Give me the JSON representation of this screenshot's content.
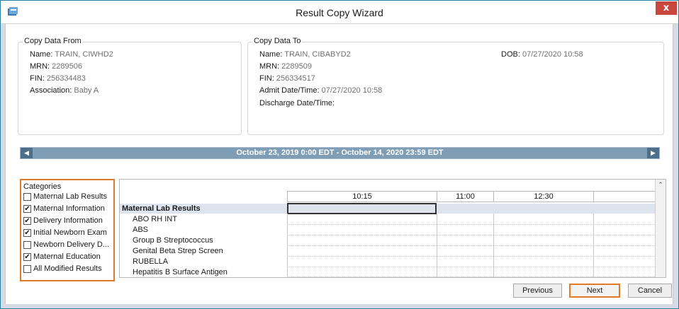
{
  "window": {
    "title": "Result Copy Wizard",
    "close_label": "x",
    "accent_color": "#e07a27"
  },
  "copy_from": {
    "title": "Copy Data From",
    "name_label": "Name:",
    "name_value": "TRAIN, CIWHD2",
    "mrn_label": "MRN:",
    "mrn_value": "2289506",
    "fin_label": "FIN:",
    "fin_value": "256334483",
    "association_label": "Association:",
    "association_value": "Baby A"
  },
  "copy_to": {
    "title": "Copy Data To",
    "name_label": "Name:",
    "name_value": "TRAIN, CIBABYD2",
    "mrn_label": "MRN:",
    "mrn_value": "2289509",
    "fin_label": "FIN:",
    "fin_value": "256334517",
    "admit_label": "Admit Date/Time:",
    "admit_value": "07/27/2020 10:58",
    "discharge_label": "Discharge Date/Time:",
    "discharge_value": "",
    "dob_label": "DOB:",
    "dob_value": "07/27/2020 10:58"
  },
  "date_range": {
    "text": "October 23, 2019 0:00 EDT - October 14, 2020 23:59 EDT",
    "prev_icon": "left-arrow-icon",
    "next_icon": "right-arrow-icon"
  },
  "categories": {
    "title": "Categories",
    "items": [
      {
        "label": "Maternal Lab Results",
        "checked": false
      },
      {
        "label": "Maternal Information",
        "checked": true
      },
      {
        "label": "Delivery Information",
        "checked": true
      },
      {
        "label": "Initial Newborn Exam",
        "checked": true
      },
      {
        "label": "Newborn Delivery D...",
        "checked": false
      },
      {
        "label": "Maternal Education",
        "checked": true
      },
      {
        "label": "All Modified Results",
        "checked": false
      }
    ]
  },
  "results_grid": {
    "columns": [
      "10:15",
      "11:00",
      "12:30"
    ],
    "section_label": "Maternal Lab Results",
    "rows": [
      "ABO RH INT",
      "ABS",
      "Group B Streptococcus",
      "Genital Beta Strep Screen",
      "RUBELLA",
      "Hepatitis B Surface Antigen"
    ]
  },
  "buttons": {
    "previous": "Previous",
    "next": "Next",
    "cancel": "Cancel"
  }
}
